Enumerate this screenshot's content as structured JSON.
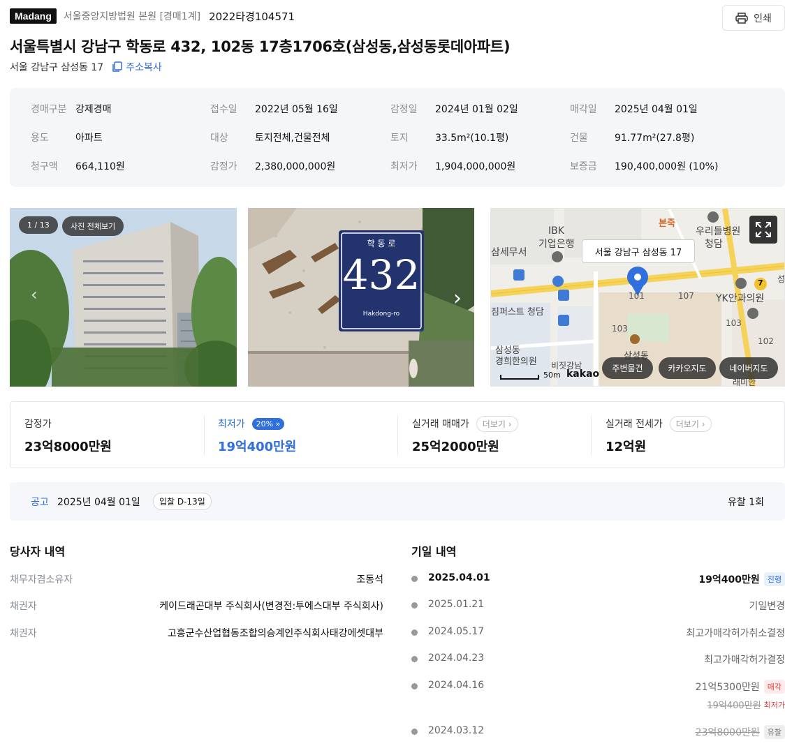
{
  "header": {
    "logo": "Madang",
    "court": "서울중앙지방법원 본원 [경매1계]",
    "case_no": "2022타경104571",
    "print_label": "인쇄"
  },
  "title": "서울특별시 강남구 학동로 432, 102동 17층1706호(삼성동,삼성동롯데아파트)",
  "sub_address": "서울 강남구 삼성동 17",
  "copy_label": "주소복사",
  "info": [
    {
      "k": "경매구분",
      "v": "강제경매"
    },
    {
      "k": "접수일",
      "v": "2022년 05월 16일"
    },
    {
      "k": "감정일",
      "v": "2024년 01월 02일"
    },
    {
      "k": "매각일",
      "v": "2025년 04월 01일"
    },
    {
      "k": "용도",
      "v": "아파트"
    },
    {
      "k": "대상",
      "v": "토지전체,건물전체"
    },
    {
      "k": "토지",
      "v": "33.5m²(10.1평)"
    },
    {
      "k": "건물",
      "v": "91.77m²(27.8평)"
    },
    {
      "k": "청구액",
      "v": "664,110원"
    },
    {
      "k": "감정가",
      "v": "2,380,000,000원"
    },
    {
      "k": "최저가",
      "v": "1,904,000,000원"
    },
    {
      "k": "보증금",
      "v": "190,400,000원 (10%)"
    }
  ],
  "photos": {
    "counter": "1 / 13",
    "view_all": "사진 전체보기",
    "sign_top": "학 동 로",
    "sign_num": "432",
    "sign_bottom": "Hakdong-ro"
  },
  "map": {
    "tooltip": "서울 강남구 삼성동 17",
    "scale": "50m",
    "brand": "kakao",
    "labels": {
      "ibk": "IBK",
      "bank": "기업은행",
      "tax": "삼세무서",
      "bonjuk": "본죽",
      "hospital": "우리들병원",
      "hospital2": "청담",
      "yk": "YK안과의원",
      "b101": "101",
      "b107": "107",
      "b103a": "103",
      "b103b": "103",
      "b102": "102",
      "first": "짐퍼스트 청담",
      "clinic1": "삼성동",
      "clinic2": "경희한의원",
      "bizit": "비짓강남",
      "samsung": "삼성동",
      "raemian": "래미안",
      "seven": "7",
      "sung": "성"
    },
    "buttons": [
      "주변물건",
      "카카오지도",
      "네이버지도"
    ]
  },
  "prices": {
    "appraisal_label": "감정가",
    "appraisal": "23억8000만원",
    "min_label": "최저가",
    "min_badge": "20%",
    "min": "19억400만원",
    "trade_label": "실거래 매매가",
    "trade": "25억2000만원",
    "jeonse_label": "실거래 전세가",
    "jeonse": "12억원",
    "more": "더보기"
  },
  "notice": {
    "label": "공고",
    "date": "2025년 04월 01일",
    "dday": "입찰 D-13일",
    "fail": "유찰 1회"
  },
  "parties_title": "당사자 내역",
  "parties": [
    {
      "k": "채무자겸소유자",
      "v": "조동석"
    },
    {
      "k": "채권자",
      "v": "케이드래곤대부 주식회사(변경전:투에스대부 주식회사)"
    },
    {
      "k": "채권자",
      "v": "고흥군수산업협동조합의승계인주식회사태강에셋대부"
    }
  ],
  "dates_title": "기일 내역",
  "dates": [
    {
      "date": "2025.04.01",
      "result": "19억400만원",
      "tag": "진행"
    },
    {
      "date": "2025.01.21",
      "result": "기일변경"
    },
    {
      "date": "2024.05.17",
      "result": "최고가매각허가취소결정"
    },
    {
      "date": "2024.04.23",
      "result": "최고가매각허가결정"
    },
    {
      "date": "2024.04.16",
      "result": "21억5300만원",
      "tag": "매각",
      "sub_result": "19억400만원",
      "sub_tag": "최저가"
    },
    {
      "date": "2024.03.12",
      "result": "23억8000만원",
      "tag": "유찰"
    }
  ],
  "colors": {
    "accent": "#2f6fde",
    "sale_tag": "#e24343",
    "label_gray": "#8a8f96"
  }
}
